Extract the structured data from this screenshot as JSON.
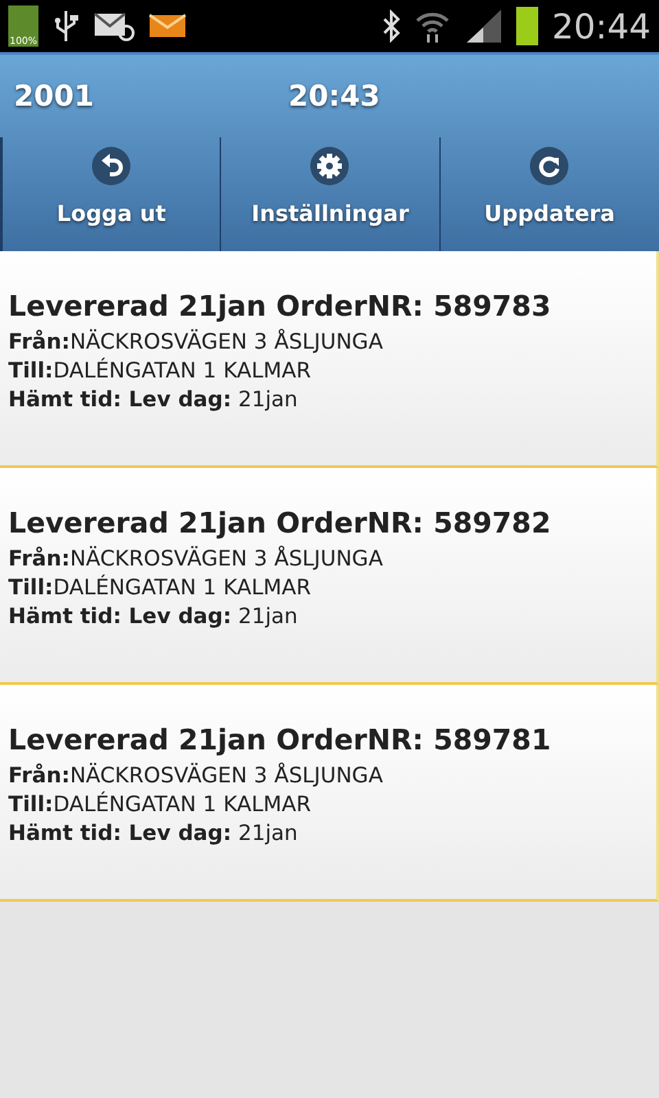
{
  "status_bar": {
    "battery_percent": "100%",
    "time": "20:44"
  },
  "header": {
    "user": "2001",
    "time": "20:43"
  },
  "toolbar": [
    {
      "kind": "logout",
      "label": "Logga ut"
    },
    {
      "kind": "settings",
      "label": "Inställningar"
    },
    {
      "kind": "refresh",
      "label": "Uppdatera"
    }
  ],
  "orders": [
    {
      "title": "Levererad 21jan OrderNR: 589783",
      "lines": [
        "**Från:**NÄCKROSVÄGEN 3 ÅSLJUNGA",
        "**Till:**DALÉNGATAN 1 KALMAR",
        "**Hämt tid: Lev dag:** 21jan"
      ]
    },
    {
      "title": "Levererad 21jan OrderNR: 589782",
      "lines": [
        "**Från:**NÄCKROSVÄGEN 3 ÅSLJUNGA",
        "**Till:**DALÉNGATAN 1 KALMAR",
        "**Hämt tid: Lev dag:** 21jan"
      ]
    },
    {
      "title": "Levererad 21jan OrderNR: 589781",
      "lines": [
        "**Från:**NÄCKROSVÄGEN 3 ÅSLJUNGA",
        "**Till:**DALÉNGATAN 1 KALMAR",
        "**Hämt tid: Lev dag:** 21jan"
      ]
    }
  ]
}
